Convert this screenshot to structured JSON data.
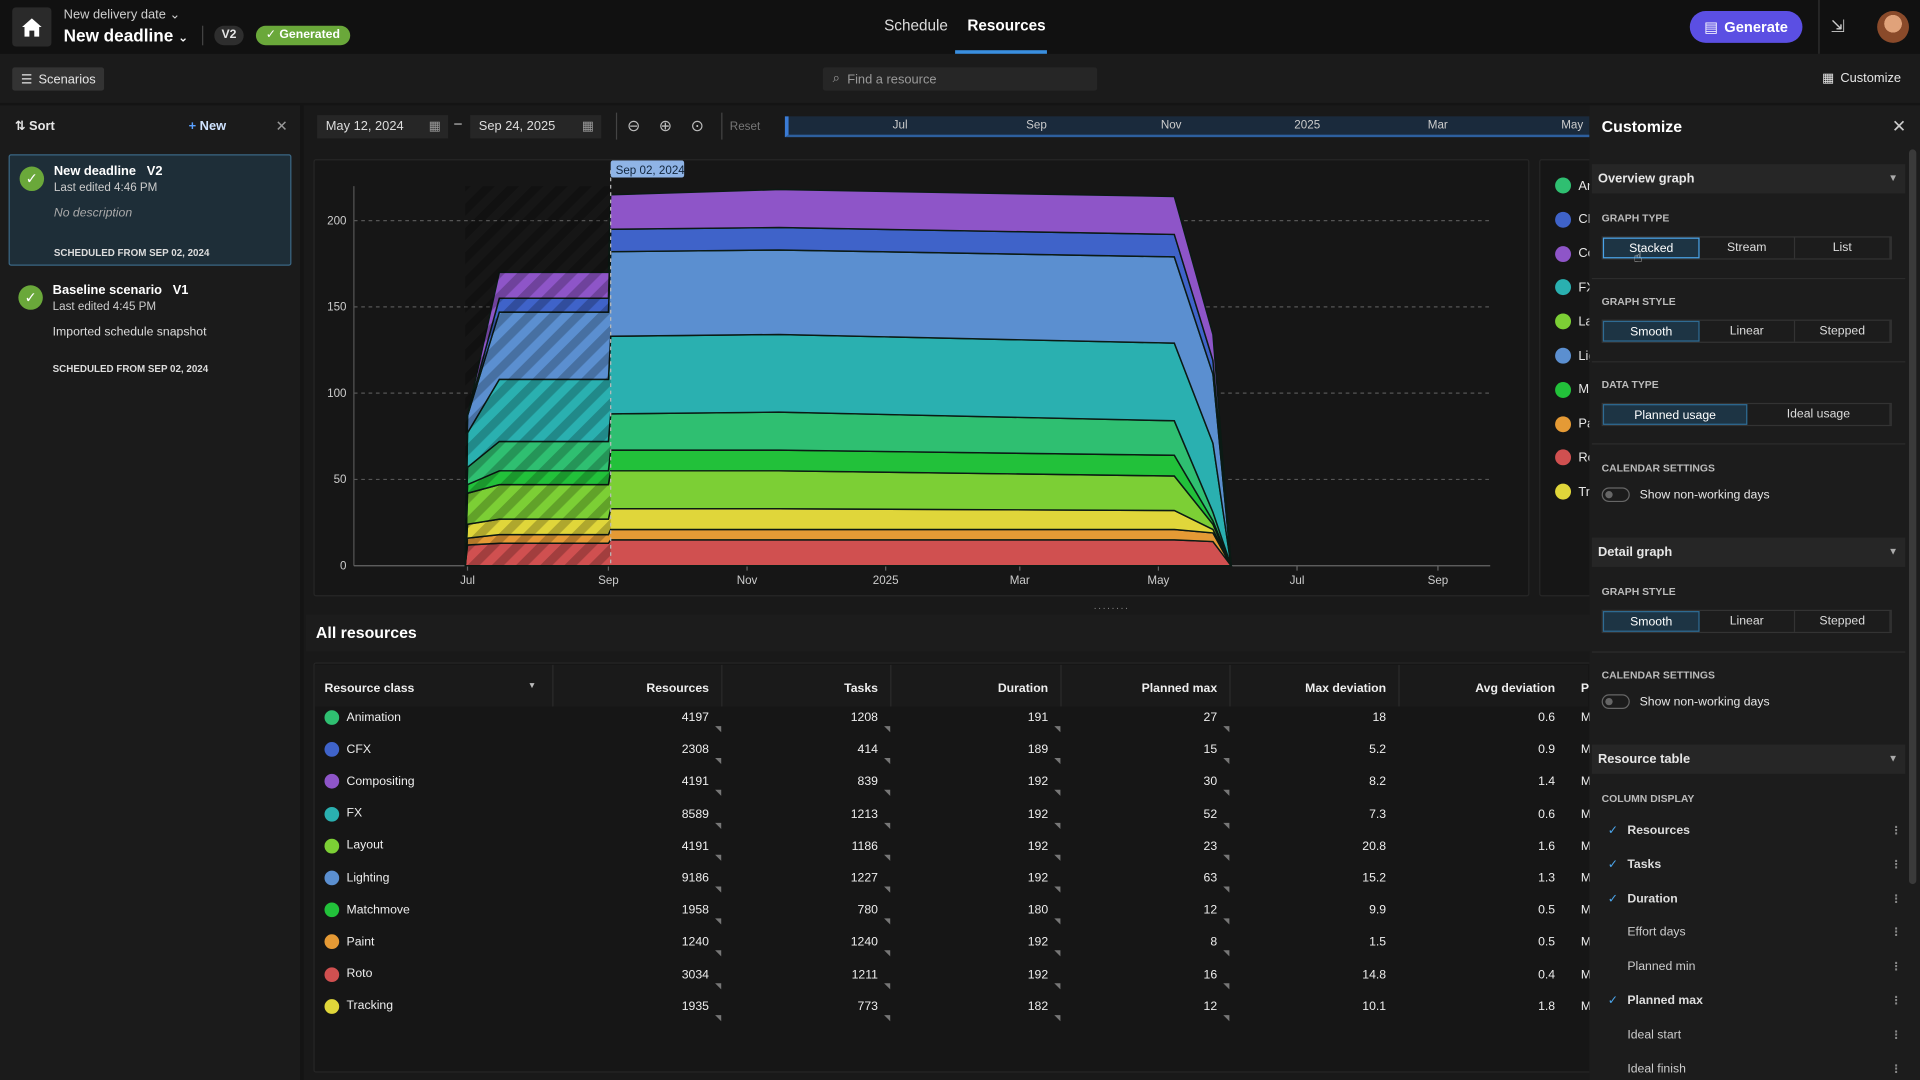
{
  "header": {
    "subtitle": "New delivery date",
    "title": "New deadline",
    "version": "V2",
    "status": "Generated",
    "tabs": [
      "Schedule",
      "Resources"
    ],
    "active_tab": "Resources",
    "generate_label": "Generate"
  },
  "toolbar": {
    "scenarios_label": "Scenarios",
    "search_placeholder": "Find a resource",
    "customize_label": "Customize"
  },
  "sidebar": {
    "sort_label": "Sort",
    "new_label": "New",
    "scenarios": [
      {
        "title": "New deadline",
        "version": "V2",
        "edited": "Last edited 4:46 PM",
        "description": "No description",
        "scheduled": "SCHEDULED FROM SEP 02, 2024",
        "selected": true
      },
      {
        "title": "Baseline scenario",
        "version": "V1",
        "edited": "Last edited 4:45 PM",
        "description": "Imported schedule snapshot",
        "scheduled": "SCHEDULED FROM SEP 02, 2024",
        "selected": false
      }
    ]
  },
  "date_range": {
    "start": "May 12, 2024",
    "end": "Sep 24, 2025",
    "reset_label": "Reset",
    "timeline_labels": [
      "Jul",
      "Sep",
      "Nov",
      "2025",
      "Mar",
      "May"
    ]
  },
  "colors": {
    "Animation": "#2fbf71",
    "CFX": "#3f63c9",
    "Compositing": "#8e55c8",
    "FX": "#2ab0b0",
    "Layout": "#7ccf35",
    "Lighting": "#5b8fd0",
    "Matchmove": "#22c13a",
    "Paint": "#e59a35",
    "Roto": "#d05050",
    "Tracking": "#e0d63a",
    "accent": "#3a8fe0",
    "generate": "#5b4fe3"
  },
  "chart_data": {
    "type": "area",
    "stacked": true,
    "marker_label": "Sep 02, 2024",
    "marker_date": "2024-09-02",
    "xlim": [
      "2024-05-12",
      "2025-09-24"
    ],
    "ylim": [
      0,
      220
    ],
    "x_ticks": [
      [
        "2024-07-01",
        "Jul"
      ],
      [
        "2024-09-01",
        "Sep"
      ],
      [
        "2024-11-01",
        "Nov"
      ],
      [
        "2025-01-01",
        "2025"
      ],
      [
        "2025-03-01",
        "Mar"
      ],
      [
        "2025-05-01",
        "May"
      ],
      [
        "2025-07-01",
        "Jul"
      ],
      [
        "2025-09-01",
        "Sep"
      ]
    ],
    "y_ticks": [
      0,
      50,
      100,
      150,
      200
    ],
    "grid": true,
    "x": [
      "2024-06-30",
      "2024-07-01",
      "2024-07-15",
      "2024-09-01",
      "2024-09-02",
      "2024-11-15",
      "2025-05-08",
      "2025-05-25",
      "2025-06-02"
    ],
    "series": [
      {
        "name": "Roto",
        "values": [
          0,
          12,
          13,
          13,
          15,
          15,
          15,
          14,
          0
        ]
      },
      {
        "name": "Paint",
        "values": [
          0,
          4,
          5,
          5,
          6,
          6,
          6,
          5,
          0
        ]
      },
      {
        "name": "Tracking",
        "values": [
          0,
          8,
          9,
          9,
          12,
          12,
          11,
          2,
          0
        ]
      },
      {
        "name": "Layout",
        "values": [
          0,
          18,
          20,
          20,
          22,
          22,
          20,
          3,
          0
        ]
      },
      {
        "name": "Matchmove",
        "values": [
          0,
          5,
          8,
          8,
          12,
          12,
          12,
          2,
          0
        ]
      },
      {
        "name": "Animation",
        "values": [
          0,
          10,
          17,
          17,
          21,
          22,
          20,
          5,
          0
        ]
      },
      {
        "name": "FX",
        "values": [
          0,
          20,
          36,
          36,
          45,
          45,
          45,
          40,
          0
        ]
      },
      {
        "name": "Lighting",
        "values": [
          0,
          10,
          39,
          39,
          49,
          49,
          50,
          40,
          0
        ]
      },
      {
        "name": "CFX",
        "values": [
          0,
          0,
          8,
          8,
          13,
          13,
          13,
          8,
          0
        ]
      },
      {
        "name": "Compositing",
        "values": [
          0,
          0,
          15,
          15,
          20,
          22,
          22,
          15,
          0
        ]
      }
    ],
    "legend": [
      "Animation",
      "CFX",
      "Compositing",
      "FX",
      "Layout",
      "Lighting",
      "Matchmove",
      "Paint",
      "Roto",
      "Tracking"
    ],
    "legend_placement": "right"
  },
  "resources": {
    "title": "All resources",
    "columns": [
      "Resource class",
      "Resources",
      "Tasks",
      "Duration",
      "Planned max",
      "Max deviation",
      "Avg deviation",
      "Pl"
    ],
    "rows": [
      [
        "Animation",
        "4197",
        "1208",
        "191",
        "27",
        "18",
        "0.6",
        "M"
      ],
      [
        "CFX",
        "2308",
        "414",
        "189",
        "15",
        "5.2",
        "0.9",
        "M"
      ],
      [
        "Compositing",
        "4191",
        "839",
        "192",
        "30",
        "8.2",
        "1.4",
        "M"
      ],
      [
        "FX",
        "8589",
        "1213",
        "192",
        "52",
        "7.3",
        "0.6",
        "M"
      ],
      [
        "Layout",
        "4191",
        "1186",
        "192",
        "23",
        "20.8",
        "1.6",
        "M"
      ],
      [
        "Lighting",
        "9186",
        "1227",
        "192",
        "63",
        "15.2",
        "1.3",
        "M"
      ],
      [
        "Matchmove",
        "1958",
        "780",
        "180",
        "12",
        "9.9",
        "0.5",
        "M"
      ],
      [
        "Paint",
        "1240",
        "1240",
        "192",
        "8",
        "1.5",
        "0.5",
        "M"
      ],
      [
        "Roto",
        "3034",
        "1211",
        "192",
        "16",
        "14.8",
        "0.4",
        "M"
      ],
      [
        "Tracking",
        "1935",
        "773",
        "182",
        "12",
        "10.1",
        "1.8",
        "M"
      ]
    ]
  },
  "customize": {
    "title": "Customize",
    "overview": {
      "title": "Overview graph",
      "graph_type_label": "GRAPH TYPE",
      "graph_types": [
        "Stacked",
        "Stream",
        "List"
      ],
      "graph_type": "Stacked",
      "graph_style_label": "GRAPH STYLE",
      "graph_styles": [
        "Smooth",
        "Linear",
        "Stepped"
      ],
      "graph_style": "Smooth",
      "data_type_label": "DATA TYPE",
      "data_types": [
        "Planned usage",
        "Ideal usage"
      ],
      "data_type": "Planned usage",
      "calendar_label": "CALENDAR SETTINGS",
      "nonworking_label": "Show non-working days",
      "nonworking": false
    },
    "detail": {
      "title": "Detail graph",
      "graph_style_label": "GRAPH STYLE",
      "graph_styles": [
        "Smooth",
        "Linear",
        "Stepped"
      ],
      "graph_style": "Smooth",
      "calendar_label": "CALENDAR SETTINGS",
      "nonworking_label": "Show non-working days",
      "nonworking": false
    },
    "table": {
      "title": "Resource table",
      "column_display_label": "COLUMN DISPLAY",
      "columns": [
        {
          "label": "Resources",
          "checked": true
        },
        {
          "label": "Tasks",
          "checked": true
        },
        {
          "label": "Duration",
          "checked": true
        },
        {
          "label": "Effort days",
          "checked": false
        },
        {
          "label": "Planned min",
          "checked": false
        },
        {
          "label": "Planned max",
          "checked": true
        },
        {
          "label": "Ideal start",
          "checked": false
        },
        {
          "label": "Ideal finish",
          "checked": false
        }
      ]
    }
  }
}
